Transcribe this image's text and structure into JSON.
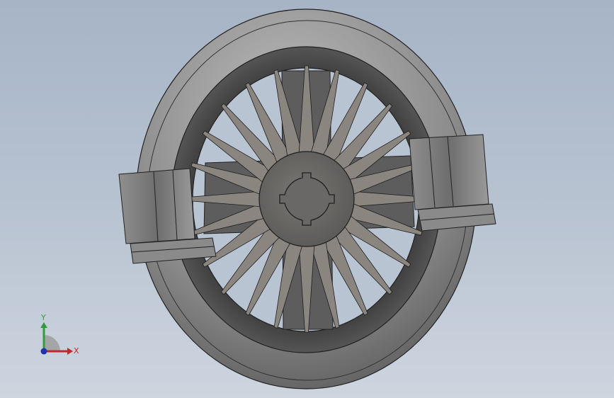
{
  "viewport": {
    "background_top": "#a6b4c6",
    "background_bottom": "#cdd5df"
  },
  "model": {
    "name": "impeller-with-housing",
    "blade_count": 24,
    "colors": {
      "housing_light": "#a9a9a9",
      "housing_dark": "#4f4f4f",
      "blade": "#8a857f",
      "hub": "#6f6d6a",
      "edge": "#1e1e1e"
    }
  },
  "triad": {
    "x_label": "X",
    "y_label": "Y",
    "x_color": "#c0282d",
    "y_color": "#2f9e3a",
    "z_color": "#2233aa"
  }
}
